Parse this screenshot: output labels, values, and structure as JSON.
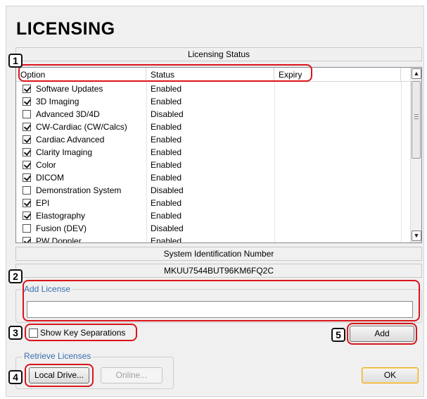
{
  "page": {
    "title": "LICENSING"
  },
  "licensing_status": {
    "header": "Licensing Status",
    "columns": [
      "Option",
      "Status",
      "Expiry"
    ],
    "rows": [
      {
        "option": "Software Updates",
        "status": "Enabled",
        "checked": true
      },
      {
        "option": "3D Imaging",
        "status": "Enabled",
        "checked": true
      },
      {
        "option": "Advanced 3D/4D",
        "status": "Disabled",
        "checked": false
      },
      {
        "option": "CW-Cardiac (CW/Calcs)",
        "status": "Enabled",
        "checked": true
      },
      {
        "option": "Cardiac Advanced",
        "status": "Enabled",
        "checked": true
      },
      {
        "option": "Clarity Imaging",
        "status": "Enabled",
        "checked": true
      },
      {
        "option": "Color",
        "status": "Enabled",
        "checked": true
      },
      {
        "option": "DICOM",
        "status": "Enabled",
        "checked": true
      },
      {
        "option": "Demonstration System",
        "status": "Disabled",
        "checked": false
      },
      {
        "option": "EPI",
        "status": "Enabled",
        "checked": true
      },
      {
        "option": "Elastography",
        "status": "Enabled",
        "checked": true
      },
      {
        "option": "Fusion (DEV)",
        "status": "Disabled",
        "checked": false
      },
      {
        "option": "PW Doppler",
        "status": "Enabled",
        "checked": true
      }
    ]
  },
  "system_id": {
    "header": "System Identification Number",
    "value": "MKUU7544BUT96KM6FQ2C"
  },
  "add_license": {
    "legend": "Add License",
    "input_value": "",
    "show_key_separations_label": "Show Key Separations",
    "show_key_separations_checked": false,
    "add_button": "Add"
  },
  "retrieve_licenses": {
    "legend": "Retrieve Licenses",
    "local_drive_button": "Local Drive...",
    "online_button": "Online..."
  },
  "ok_button": "OK",
  "callouts": [
    "1",
    "2",
    "3",
    "4",
    "5"
  ],
  "colors": {
    "callout": "#d9151b",
    "legend_text": "#3a6fb0",
    "default_button": "#e6a91e"
  }
}
